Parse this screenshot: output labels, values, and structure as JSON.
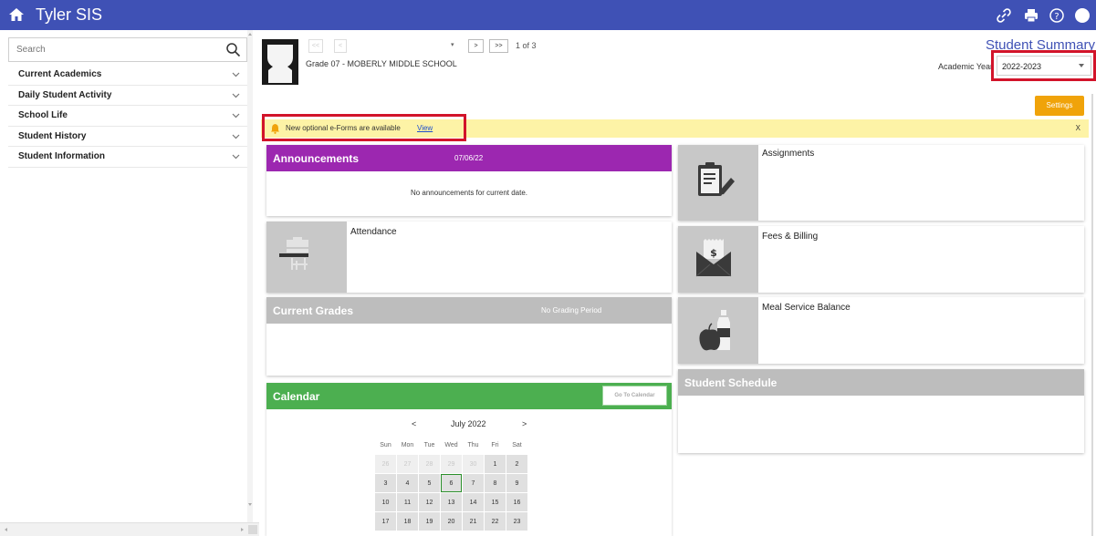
{
  "app": {
    "title": "Tyler SIS"
  },
  "search": {
    "placeholder": "Search"
  },
  "sidebar": {
    "items": [
      {
        "label": "Current Academics"
      },
      {
        "label": "Daily Student Activity"
      },
      {
        "label": "School Life"
      },
      {
        "label": "Student History"
      },
      {
        "label": "Student Information"
      }
    ]
  },
  "pager": {
    "first": "<<",
    "prev": "<",
    "next": ">",
    "last": ">>",
    "dropdown": "▾",
    "count": "1 of 3"
  },
  "student": {
    "grade_school": "Grade 07 - MOBERLY MIDDLE SCHOOL"
  },
  "summary": {
    "title": "Student Summary",
    "academic_year_label": "Academic Year",
    "academic_year": "2022-2023",
    "settings": "Settings"
  },
  "notice": {
    "text": "New optional e-Forms are available",
    "link": "View",
    "close": "X"
  },
  "announcements": {
    "title": "Announcements",
    "date": "07/06/22",
    "message": "No announcements for current date."
  },
  "attendance": {
    "title": "Attendance"
  },
  "grades": {
    "title": "Current Grades",
    "period": "No Grading Period"
  },
  "calendar": {
    "title": "Calendar",
    "go_button": "Go To Calendar",
    "prev": "<",
    "month": "July 2022",
    "next": ">",
    "weekdays": [
      "Sun",
      "Mon",
      "Tue",
      "Wed",
      "Thu",
      "Fri",
      "Sat"
    ],
    "today": "6",
    "weeks": [
      [
        "26",
        "27",
        "28",
        "29",
        "30",
        "1",
        "2"
      ],
      [
        "3",
        "4",
        "5",
        "6",
        "7",
        "8",
        "9"
      ],
      [
        "10",
        "11",
        "12",
        "13",
        "14",
        "15",
        "16"
      ],
      [
        "17",
        "18",
        "19",
        "20",
        "21",
        "22",
        "23"
      ]
    ]
  },
  "assignments": {
    "title": "Assignments"
  },
  "fees": {
    "title": "Fees & Billing"
  },
  "meal": {
    "title": "Meal Service Balance"
  },
  "schedule": {
    "title": "Student Schedule"
  },
  "colors": {
    "topbar": "#3f51b5",
    "announcements": "#9c27b0",
    "calendar": "#4caf50",
    "grey_header": "#bdbdbd",
    "settings": "#f0a30a",
    "notice": "#fdf3a6",
    "highlight": "#d2142a"
  }
}
